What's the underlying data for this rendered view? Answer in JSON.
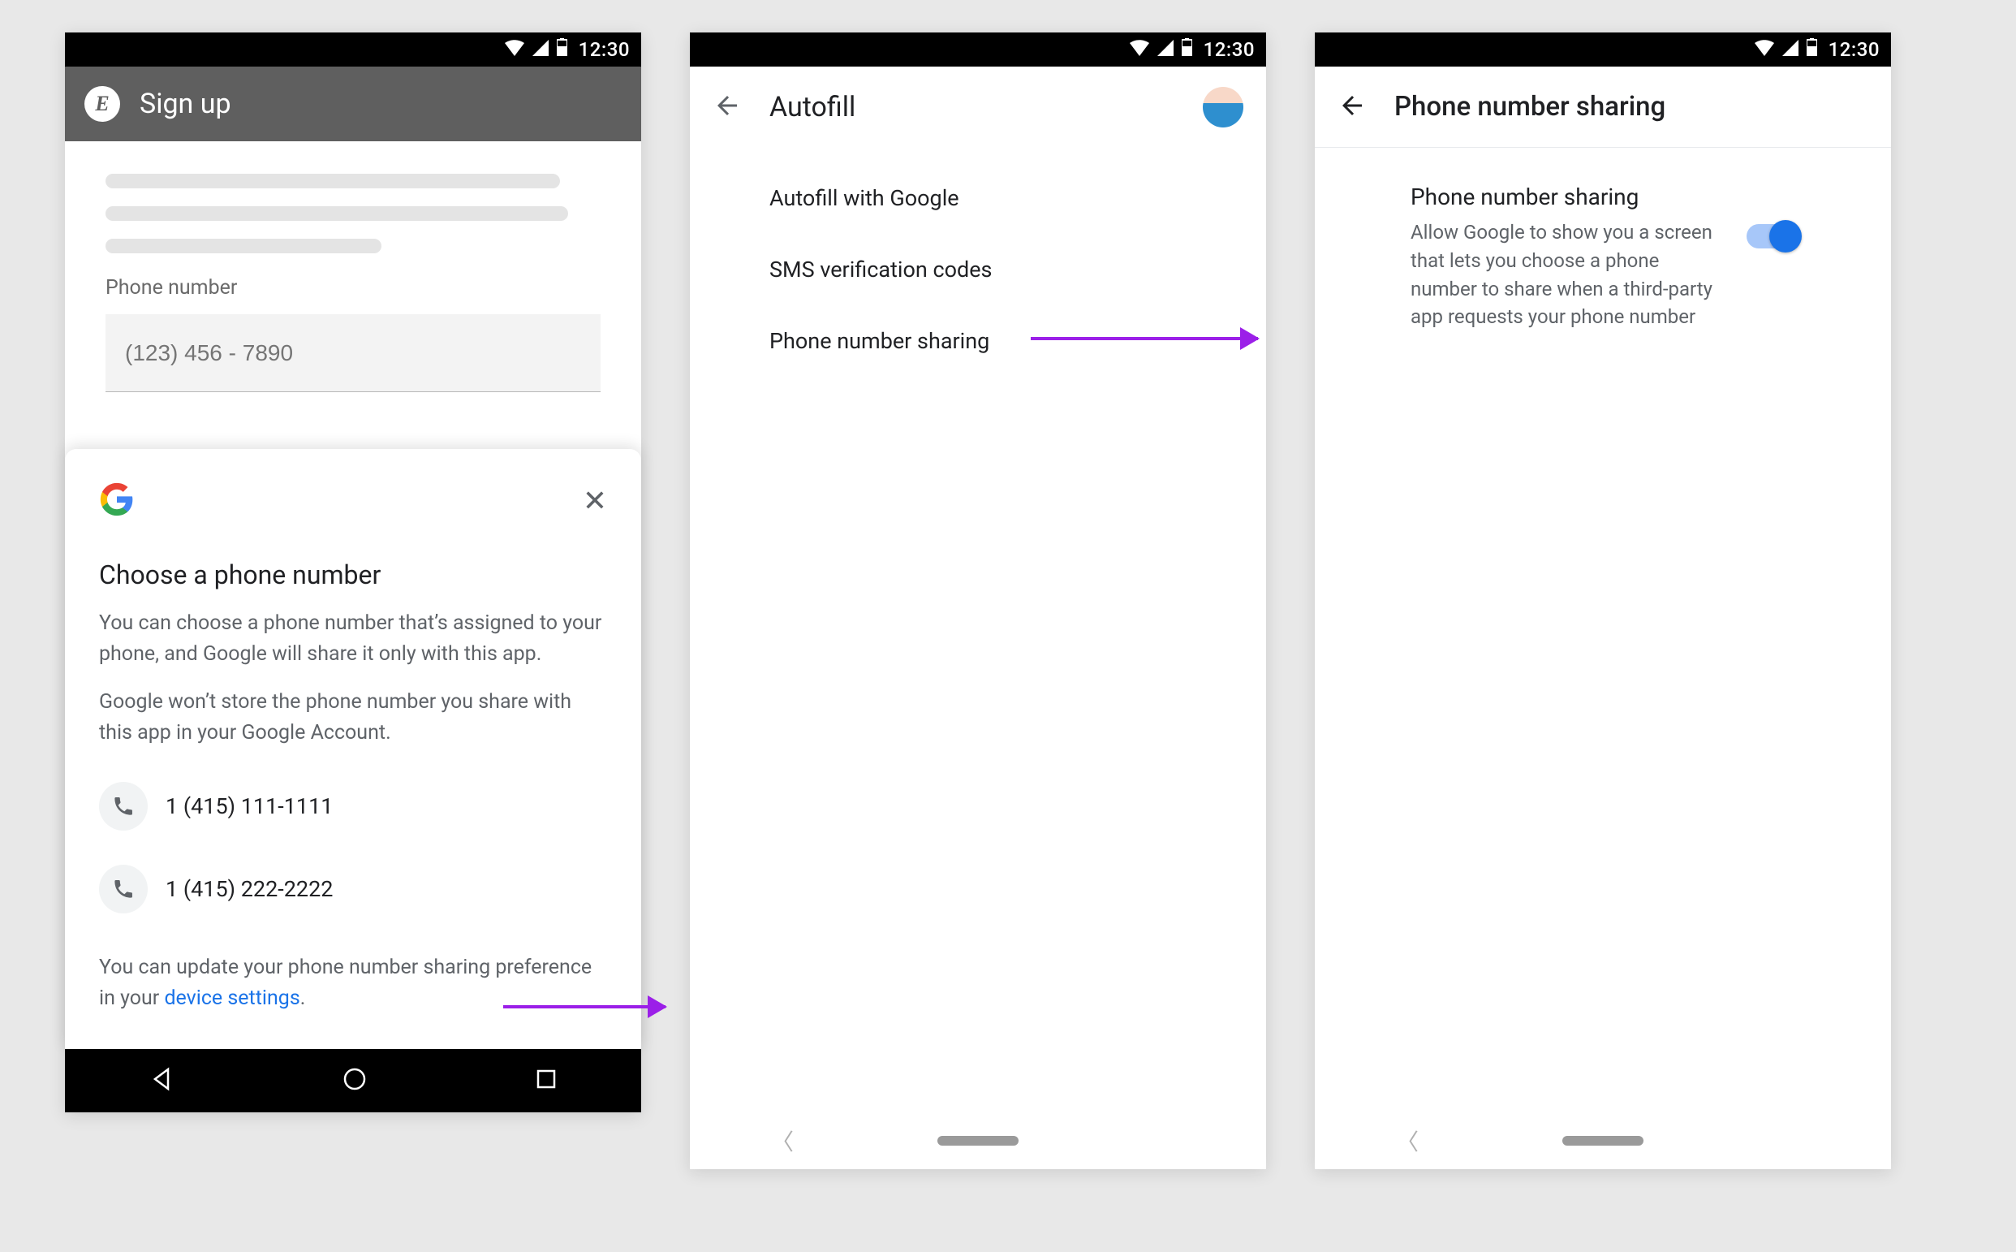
{
  "statusbar": {
    "time": "12:30"
  },
  "screen1": {
    "header_title": "Sign up",
    "field_label": "Phone number",
    "field_placeholder": "(123) 456 - 7890",
    "sheet": {
      "title": "Choose a phone number",
      "p1": "You can choose a phone number that’s assigned to your phone, and Google will share it only with this app.",
      "p2": "Google won’t store the phone number you share with this app in your Google Account.",
      "numbers": [
        "1 (415) 111-1111",
        "1 (415) 222-2222"
      ],
      "footer_pre": "You can update your phone number sharing preference in your ",
      "footer_link": "device settings",
      "footer_post": "."
    }
  },
  "screen2": {
    "title": "Autofill",
    "items": [
      "Autofill with Google",
      "SMS verification codes",
      "Phone number sharing"
    ]
  },
  "screen3": {
    "title": "Phone number sharing",
    "setting_title": "Phone number sharing",
    "setting_desc": "Allow Google to show you a screen that lets you choose a phone number to share when a third-party app requests your phone number"
  }
}
